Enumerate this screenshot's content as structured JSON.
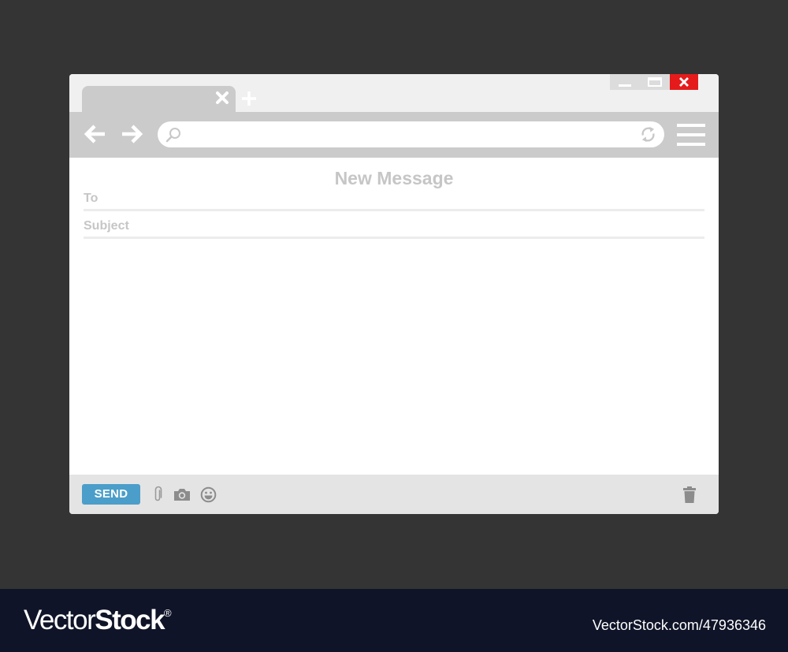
{
  "window": {
    "tab": {
      "close_icon": "close-x-icon"
    },
    "new_tab_icon": "plus-icon",
    "controls": {
      "minimize_icon": "minimize-icon",
      "maximize_icon": "maximize-icon",
      "close_icon": "close-x-icon",
      "close_color": "#e51b1b"
    },
    "toolbar": {
      "back_icon": "arrow-left-icon",
      "forward_icon": "arrow-right-icon",
      "address": {
        "value": "",
        "placeholder": ""
      },
      "search_icon": "search-icon",
      "refresh_icon": "refresh-icon",
      "menu_icon": "hamburger-menu-icon"
    }
  },
  "compose": {
    "title": "New Message",
    "to_label": "To",
    "subject_label": "Subject",
    "body": ""
  },
  "footer": {
    "send_label": "SEND",
    "send_color": "#4b9ec9",
    "icons": [
      "paperclip-icon",
      "camera-icon",
      "emoji-icon",
      "trash-icon"
    ]
  },
  "watermark": {
    "logo_regular": "Vector",
    "logo_bold": "Stock",
    "logo_mark": "®",
    "image_id": "VectorStock.com/47936346"
  }
}
